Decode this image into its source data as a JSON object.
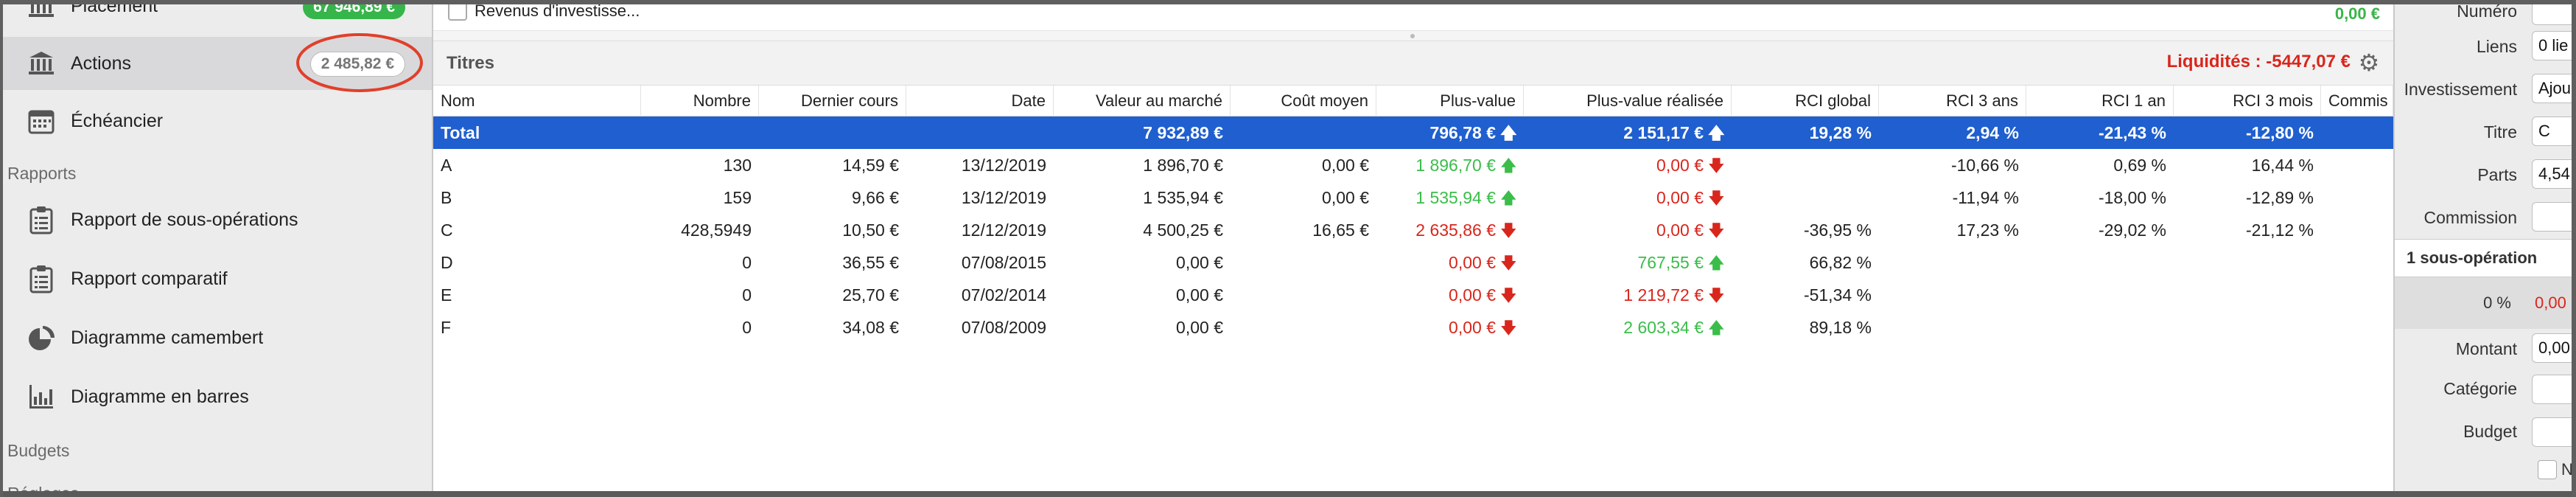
{
  "sidebar": {
    "items": [
      {
        "label": "Placement",
        "badge": "67 946,89 €",
        "icon": "bank-icon"
      },
      {
        "label": "Actions",
        "badge": "2 485,82 €",
        "icon": "bank-icon"
      },
      {
        "label": "Échéancier",
        "icon": "calendar-icon"
      }
    ],
    "section_reports": "Rapports",
    "reports": [
      {
        "label": "Rapport de sous-opérations",
        "icon": "clipboard-icon"
      },
      {
        "label": "Rapport comparatif",
        "icon": "clipboard-icon"
      },
      {
        "label": "Diagramme camembert",
        "icon": "pie-chart-icon"
      },
      {
        "label": "Diagramme en barres",
        "icon": "bar-chart-icon"
      }
    ],
    "section_budgets": "Budgets",
    "section_settings": "Réglages"
  },
  "top_strip": {
    "label": "Revenus d'investisse...",
    "amount": "0,00 €"
  },
  "panel": {
    "title": "Titres",
    "liquidity": "Liquidités : -5447,07 €",
    "gear_icon": "gear-icon"
  },
  "table": {
    "columns": [
      "Nom",
      "Nombre",
      "Dernier cours",
      "Date",
      "Valeur au marché",
      "Coût moyen",
      "Plus-value",
      "Plus-value réalisée",
      "RCI global",
      "RCI 3 ans",
      "RCI 1 an",
      "RCI 3 mois",
      "Commis"
    ],
    "total": {
      "name": "Total",
      "market_value": "7 932,89 €",
      "gain": "796,78 €",
      "realized": "2 151,17 €",
      "rci_global": "19,28 %",
      "rci_3y": "2,94 %",
      "rci_1y": "-21,43 %",
      "rci_3m": "-12,80 %"
    },
    "rows": [
      {
        "name": "A",
        "count": "130",
        "last": "14,59 €",
        "date": "13/12/2019",
        "market": "1 896,70 €",
        "avg_cost": "0,00 €",
        "gain": "1 896,70 €",
        "gain_dir": "up",
        "realized": "0,00 €",
        "realized_dir": "down",
        "rci_global": "",
        "rci_3y": "-10,66 %",
        "rci_1y": "0,69 %",
        "rci_3m": "16,44 %"
      },
      {
        "name": "B",
        "count": "159",
        "last": "9,66 €",
        "date": "13/12/2019",
        "market": "1 535,94 €",
        "avg_cost": "0,00 €",
        "gain": "1 535,94 €",
        "gain_dir": "up",
        "realized": "0,00 €",
        "realized_dir": "down",
        "rci_global": "",
        "rci_3y": "-11,94 %",
        "rci_1y": "-18,00 %",
        "rci_3m": "-12,89 %"
      },
      {
        "name": "C",
        "count": "428,5949",
        "last": "10,50 €",
        "date": "12/12/2019",
        "market": "4 500,25 €",
        "avg_cost": "16,65 €",
        "gain": "2 635,86 €",
        "gain_dir": "down",
        "realized": "0,00 €",
        "realized_dir": "down",
        "rci_global": "-36,95 %",
        "rci_3y": "17,23 %",
        "rci_1y": "-29,02 %",
        "rci_3m": "-21,12 %"
      },
      {
        "name": "D",
        "count": "0",
        "last": "36,55 €",
        "date": "07/08/2015",
        "market": "0,00 €",
        "avg_cost": "",
        "gain": "0,00 €",
        "gain_dir": "down",
        "realized": "767,55 €",
        "realized_dir": "up",
        "rci_global": "66,82 %",
        "rci_3y": "",
        "rci_1y": "",
        "rci_3m": ""
      },
      {
        "name": "E",
        "count": "0",
        "last": "25,70 €",
        "date": "07/02/2014",
        "market": "0,00 €",
        "avg_cost": "",
        "gain": "0,00 €",
        "gain_dir": "down",
        "realized": "1 219,72 €",
        "realized_dir": "down",
        "rci_global": "-51,34 %",
        "rci_3y": "",
        "rci_1y": "",
        "rci_3m": ""
      },
      {
        "name": "F",
        "count": "0",
        "last": "34,08 €",
        "date": "07/08/2009",
        "market": "0,00 €",
        "avg_cost": "",
        "gain": "0,00 €",
        "gain_dir": "down",
        "realized": "2 603,34 €",
        "realized_dir": "up",
        "rci_global": "89,18 %",
        "rci_3y": "",
        "rci_1y": "",
        "rci_3m": ""
      }
    ]
  },
  "right_panel": {
    "labels": {
      "numero": "Numéro",
      "liens": "Liens",
      "investissement": "Investissement",
      "titre": "Titre",
      "parts": "Parts",
      "commission": "Commission",
      "montant": "Montant",
      "categorie": "Catégorie",
      "budget": "Budget"
    },
    "values": {
      "liens": "0 lie",
      "investissement": "Ajou",
      "titre": "C",
      "parts": "4,54",
      "montant": "0,00"
    },
    "sub_section": "1 sous-opération",
    "sub_percent": "0 %",
    "sub_amount": "0,00",
    "checkbox_label": "Ne"
  },
  "colors": {
    "accent_blue": "#1f5fcf",
    "positive": "#3bbd4a",
    "negative": "#d9261c",
    "annotation": "#e0402a"
  }
}
